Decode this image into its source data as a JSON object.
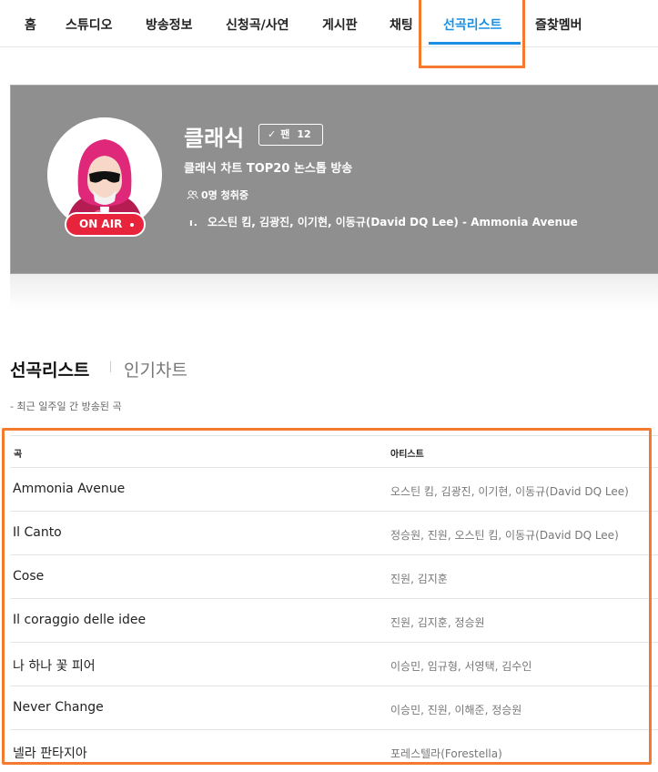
{
  "nav": {
    "items": [
      {
        "label": "홈"
      },
      {
        "label": "스튜디오"
      },
      {
        "label": "방송정보"
      },
      {
        "label": "신청곡/사연"
      },
      {
        "label": "게시판"
      },
      {
        "label": "채팅"
      },
      {
        "label": "선곡리스트",
        "active": true
      },
      {
        "label": "즐찾멤버"
      }
    ]
  },
  "channel": {
    "title": "클래식",
    "fan_label": "팬",
    "fan_count": "12",
    "description": "클래식 차트 TOP20 논스톱 방송",
    "listeners": "0명 청취중",
    "now_playing": "오스틴 킴, 김광진, 이기현, 이동규(David DQ Lee) - Ammonia Avenue",
    "on_air": "ON AIR",
    "accent_color": "#e8243c"
  },
  "section": {
    "title": "선곡리스트",
    "tab2": "인기차트",
    "note": "- 최근 일주일 간 방송된 곡"
  },
  "table": {
    "col_title": "곡",
    "col_artist": "아티스트",
    "rows": [
      {
        "title": "Ammonia Avenue",
        "artist": "오스틴 킴, 김광진, 이기현, 이동규(David DQ Lee)"
      },
      {
        "title": "Il Canto",
        "artist": "정승원, 진원, 오스틴 킴, 이동규(David DQ Lee)"
      },
      {
        "title": "Cose",
        "artist": "진원, 김지훈"
      },
      {
        "title": "Il coraggio delle idee",
        "artist": "진원, 김지훈, 정승원"
      },
      {
        "title": "나 하나 꽃 피어",
        "artist": "이승민, 임규형, 서영택, 김수인"
      },
      {
        "title": "Never Change",
        "artist": "이승민, 진원, 이해준, 정승원"
      },
      {
        "title": "넬라 판타지아",
        "artist": "포레스텔라(Forestella)"
      }
    ]
  },
  "colors": {
    "active_tab": "#1a8fe3",
    "highlight": "#f47a2f",
    "banner_bg": "#8f8f8f"
  }
}
